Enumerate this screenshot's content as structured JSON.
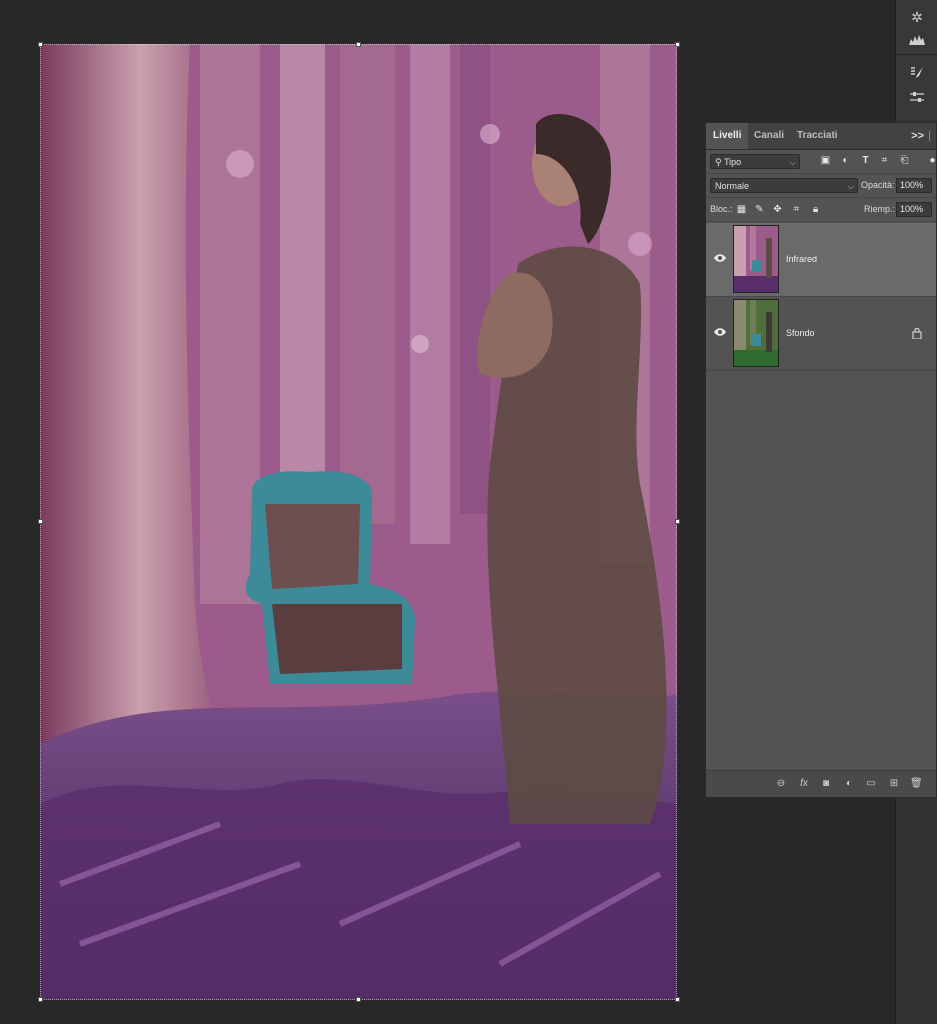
{
  "layers_panel": {
    "tabs": [
      {
        "label": "Livelli"
      },
      {
        "label": "Canali"
      },
      {
        "label": "Tracciati"
      }
    ],
    "more_label": ">>",
    "filter": {
      "kind_label": "Tipo"
    },
    "blend": {
      "mode": "Normale",
      "opacity_label": "Opacità:",
      "opacity_value": "100%"
    },
    "lock": {
      "label": "Bloc.:",
      "fill_label": "Riemp.:",
      "fill_value": "100%"
    },
    "layers": [
      {
        "name": "Infrared",
        "visible": true,
        "selected": true,
        "locked": false
      },
      {
        "name": "Sfondo",
        "visible": true,
        "selected": false,
        "locked": true
      }
    ],
    "footer_fx_label": "fx"
  },
  "colors": {
    "app_bg": "#282828",
    "panel_bg": "#535353",
    "selected_layer": "#6a6a6a",
    "infrared_tint": "#a1668f",
    "background_green": "#4f7d45"
  }
}
